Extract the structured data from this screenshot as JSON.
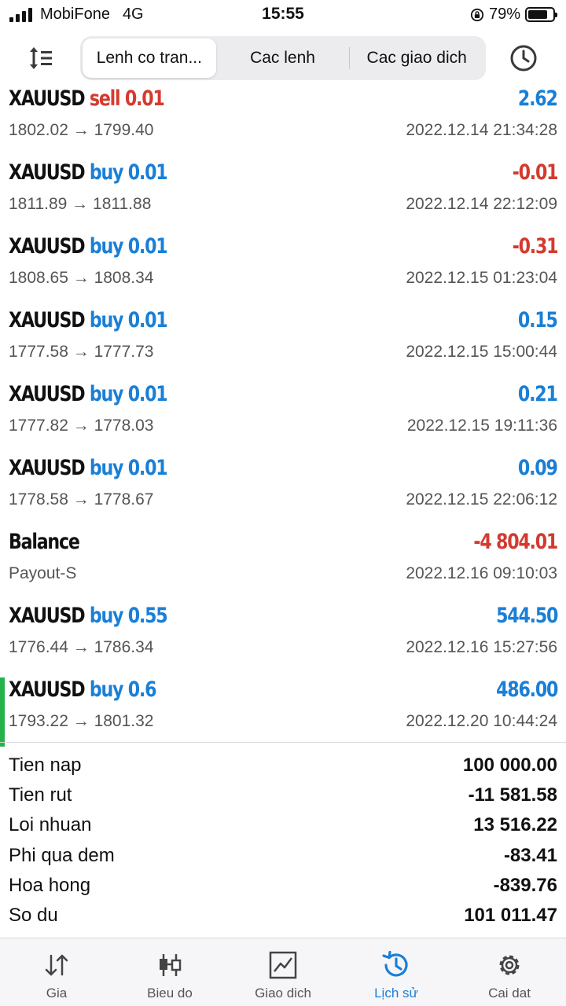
{
  "status_bar": {
    "carrier": "MobiFone",
    "network": "4G",
    "time": "15:55",
    "battery": "79%",
    "battery_level": 0.79
  },
  "toolbar": {
    "sort_icon": "sort-icon",
    "clock_icon": "clock-icon",
    "segments": [
      {
        "label": "Lenh co tran...",
        "active": true
      },
      {
        "label": "Cac lenh",
        "active": false
      },
      {
        "label": "Cac giao dich",
        "active": false
      }
    ]
  },
  "history": [
    {
      "symbol": "XAUUSD",
      "side": "sell",
      "volume": "0.01",
      "prices": "1802.02 → 1799.40",
      "profit": "2.62",
      "time": "2022.12.14 21:34:28"
    },
    {
      "symbol": "XAUUSD",
      "side": "buy",
      "volume": "0.01",
      "prices": "1811.89 → 1811.88",
      "profit": "-0.01",
      "time": "2022.12.14 22:12:09"
    },
    {
      "symbol": "XAUUSD",
      "side": "buy",
      "volume": "0.01",
      "prices": "1808.65 → 1808.34",
      "profit": "-0.31",
      "time": "2022.12.15 01:23:04"
    },
    {
      "symbol": "XAUUSD",
      "side": "buy",
      "volume": "0.01",
      "prices": "1777.58 → 1777.73",
      "profit": "0.15",
      "time": "2022.12.15 15:00:44"
    },
    {
      "symbol": "XAUUSD",
      "side": "buy",
      "volume": "0.01",
      "prices": "1777.82 → 1778.03",
      "profit": "0.21",
      "time": "2022.12.15 19:11:36"
    },
    {
      "symbol": "XAUUSD",
      "side": "buy",
      "volume": "0.01",
      "prices": "1778.58 → 1778.67",
      "profit": "0.09",
      "time": "2022.12.15 22:06:12"
    },
    {
      "symbol": "Balance",
      "side": "",
      "volume": "",
      "prices": "Payout-S",
      "profit": "-4 804.01",
      "time": "2022.12.16 09:10:03"
    },
    {
      "symbol": "XAUUSD",
      "side": "buy",
      "volume": "0.55",
      "prices": "1776.44 → 1786.34",
      "profit": "544.50",
      "time": "2022.12.16 15:27:56"
    },
    {
      "symbol": "XAUUSD",
      "side": "buy",
      "volume": "0.6",
      "prices": "1793.22 → 1801.32",
      "profit": "486.00",
      "time": "2022.12.20 10:44:24",
      "marked": true
    }
  ],
  "summary": [
    {
      "label": "Tien nap",
      "value": "100 000.00"
    },
    {
      "label": "Tien rut",
      "value": "-11 581.58"
    },
    {
      "label": "Loi nhuan",
      "value": "13 516.22"
    },
    {
      "label": "Phi qua dem",
      "value": "-83.41"
    },
    {
      "label": "Hoa hong",
      "value": "-839.76"
    },
    {
      "label": "So du",
      "value": "101 011.47"
    }
  ],
  "colors": {
    "positive": "#1a7fd6",
    "negative": "#d43a2f",
    "marker": "#26b24a",
    "tab_active": "#1a7fd6"
  },
  "tabbar": [
    {
      "label": "Gia",
      "icon": "arrows-updown-icon",
      "active": false
    },
    {
      "label": "Bieu do",
      "icon": "candlestick-icon",
      "active": false
    },
    {
      "label": "Giao dich",
      "icon": "trade-chart-icon",
      "active": false
    },
    {
      "label": "Lịch sử",
      "icon": "history-icon",
      "active": true
    },
    {
      "label": "Cai dat",
      "icon": "gear-icon",
      "active": false
    }
  ]
}
